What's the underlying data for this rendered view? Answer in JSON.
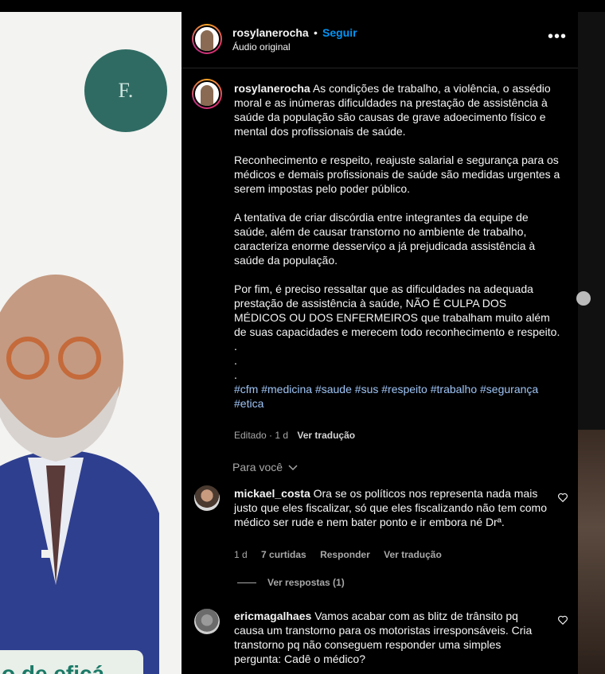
{
  "video": {
    "logo_text": "F.",
    "caption": "o de eficá"
  },
  "header": {
    "username": "rosylanerocha",
    "dot": "•",
    "follow_label": "Seguir",
    "audio": "Áudio original",
    "more_icon": "more-horizontal-icon"
  },
  "caption": {
    "username": "rosylanerocha",
    "p1": "As condições de trabalho, a violência, o assédio moral e as inúmeras dificuldades na prestação de assistência à saúde da população são causas de grave adoecimento físico e mental dos profissionais de saúde.",
    "p2": "Reconhecimento e respeito, reajuste salarial e segurança para os médicos e demais profissionais de saúde são medidas urgentes a serem impostas pelo poder público.",
    "p3": "A tentativa de criar discórdia entre integrantes da equipe de saúde, além de causar transtorno no ambiente de trabalho, caracteriza enorme desserviço a já prejudicada assistência à saúde da população.",
    "p4": "Por fim, é preciso ressaltar que as dificuldades na adequada prestação de assistência à saúde, NÃO É CULPA DOS MÉDICOS OU DOS ENFERMEIROS que trabalham muito além de suas capacidades e merecem todo reconhecimento e respeito.",
    "dots": [
      ".",
      ".",
      "."
    ],
    "hashtags": [
      "#cfm",
      "#medicina",
      "#saude",
      "#sus",
      "#respeito",
      "#trabalho",
      "#segurança",
      "#etica"
    ]
  },
  "post_meta": {
    "edited": "Editado · 1 d",
    "translate": "Ver tradução"
  },
  "for_you": "Para você",
  "comments": [
    {
      "username": "mickael_costa",
      "text": "Ora se os políticos nos representa nada mais justo que eles fiscalizar, só que eles fiscalizando não tem como médico ser rude e nem bater ponto e ir embora né Drª.",
      "time": "1 d",
      "likes": "7 curtidas",
      "reply": "Responder",
      "translate": "Ver tradução",
      "view_replies": "Ver respostas (1)"
    },
    {
      "username": "ericmagalhaes",
      "text": "Vamos acabar com as blitz de trânsito pq causa um transtorno para os motoristas irresponsáveis. Cria transtorno pq não conseguem responder uma simples pergunta: Cadê o médico?"
    }
  ],
  "colors": {
    "accent": "#0095f6",
    "background": "#000000",
    "secondary_text": "#a8a8a8",
    "hashtag": "#9ec4f5"
  }
}
